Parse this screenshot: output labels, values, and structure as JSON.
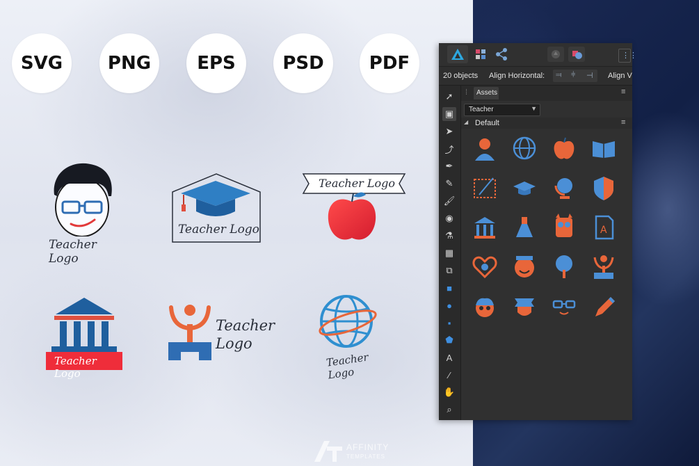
{
  "formats": [
    "SVG",
    "PNG",
    "EPS",
    "PSD",
    "PDF"
  ],
  "logos": {
    "boy": "Teacher Logo",
    "cap": "Teacher Logo",
    "apple": "Teacher Logo",
    "temple": "Teacher Logo",
    "person_line1": "Teacher",
    "person_line2": "Logo",
    "globe": "Teacher Logo"
  },
  "window": {
    "selection_count": "20 objects",
    "align_label": "Align Horizontal:",
    "align_v_label": "Align V",
    "panel_tab": "Assets",
    "category_select": "Teacher",
    "subcategory": "Default"
  },
  "tools": [
    "move-tool-icon",
    "artboard-tool-icon",
    "node-tool-icon",
    "corner-tool-icon",
    "pen-tool-icon",
    "pencil-tool-icon",
    "brush-tool-icon",
    "color-picker-icon",
    "fill-tool-icon",
    "image-tool-icon",
    "crop-tool-icon",
    "rectangle-tool-icon",
    "ellipse-tool-icon",
    "rounded-rect-tool-icon",
    "polygon-tool-icon",
    "text-tool-icon",
    "eyedropper-tool-icon",
    "hand-tool-icon",
    "zoom-tool-icon"
  ],
  "assets": [
    "teacher-avatar-icon",
    "globe-icon",
    "apple-icon",
    "book-icon",
    "pointer-board-icon",
    "graduation-cap-icon",
    "desk-globe-icon",
    "shield-icon",
    "museum-icon",
    "flask-icon",
    "owl-icon",
    "grade-paper-icon",
    "heart-icon",
    "smiley-icon",
    "tree-icon",
    "person-podium-icon",
    "boy-face-icon",
    "banner-icon",
    "glasses-smile-icon",
    "pencil-icon"
  ],
  "watermark": {
    "line1": "AFFINITY",
    "line2": "TEMPLATES"
  },
  "colors": {
    "blue": "#2f6db3",
    "red": "#ee4a3c",
    "orange": "#e8663a",
    "dark_ui": "#2b2b2b"
  }
}
